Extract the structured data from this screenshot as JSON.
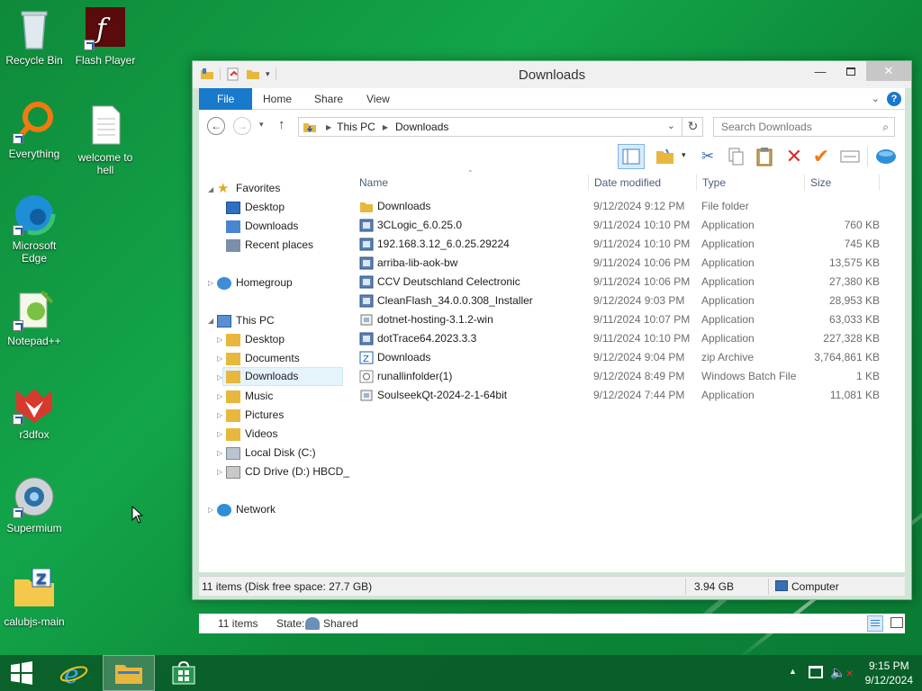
{
  "desktop": {
    "icons": [
      {
        "label": "Recycle Bin"
      },
      {
        "label": "Flash Player"
      },
      {
        "label": "Everything"
      },
      {
        "label": "welcome to hell"
      },
      {
        "label": "Microsoft Edge"
      },
      {
        "label": "Notepad++"
      },
      {
        "label": "r3dfox"
      },
      {
        "label": "Supermium"
      },
      {
        "label": "calubjs-main"
      }
    ]
  },
  "window": {
    "title": "Downloads",
    "ribbon_tabs": [
      "File",
      "Home",
      "Share",
      "View"
    ],
    "address": {
      "segments": [
        "This PC",
        "Downloads"
      ]
    },
    "search_placeholder": "Search Downloads",
    "nav": {
      "favorites": "Favorites",
      "favorites_items": [
        "Desktop",
        "Downloads",
        "Recent places"
      ],
      "homegroup": "Homegroup",
      "this_pc": "This PC",
      "this_pc_items": [
        "Desktop",
        "Documents",
        "Downloads",
        "Music",
        "Pictures",
        "Videos",
        "Local Disk (C:)",
        "CD Drive (D:) HBCD_"
      ],
      "network": "Network"
    },
    "columns": {
      "name": "Name",
      "date": "Date modified",
      "type": "Type",
      "size": "Size"
    },
    "files": [
      {
        "name": "Downloads",
        "date": "9/12/2024 9:12 PM",
        "type": "File folder",
        "size": "",
        "icon": "folder-icon"
      },
      {
        "name": "3CLogic_6.0.25.0",
        "date": "9/11/2024 10:10 PM",
        "type": "Application",
        "size": "760 KB",
        "icon": "app-icon"
      },
      {
        "name": "192.168.3.12_6.0.25.29224",
        "date": "9/11/2024 10:10 PM",
        "type": "Application",
        "size": "745 KB",
        "icon": "app-icon"
      },
      {
        "name": "arriba-lib-aok-bw",
        "date": "9/11/2024 10:06 PM",
        "type": "Application",
        "size": "13,575 KB",
        "icon": "app-icon"
      },
      {
        "name": "CCV Deutschland Celectronic",
        "date": "9/11/2024 10:06 PM",
        "type": "Application",
        "size": "27,380 KB",
        "icon": "app-icon"
      },
      {
        "name": "CleanFlash_34.0.0.308_Installer",
        "date": "9/12/2024 9:03 PM",
        "type": "Application",
        "size": "28,953 KB",
        "icon": "app-icon"
      },
      {
        "name": "dotnet-hosting-3.1.2-win",
        "date": "9/11/2024 10:07 PM",
        "type": "Application",
        "size": "63,033 KB",
        "icon": "installer-icon"
      },
      {
        "name": "dotTrace64.2023.3.3",
        "date": "9/11/2024 10:10 PM",
        "type": "Application",
        "size": "227,328 KB",
        "icon": "app-icon"
      },
      {
        "name": "Downloads",
        "date": "9/12/2024 9:04 PM",
        "type": "zip Archive",
        "size": "3,764,861 KB",
        "icon": "zip-icon"
      },
      {
        "name": "runallinfolder(1)",
        "date": "9/12/2024 8:49 PM",
        "type": "Windows Batch File",
        "size": "1 KB",
        "icon": "batch-icon"
      },
      {
        "name": "SoulseekQt-2024-2-1-64bit",
        "date": "9/12/2024 7:44 PM",
        "type": "Application",
        "size": "11,081 KB",
        "icon": "installer-icon"
      }
    ],
    "status": {
      "items": "11 items",
      "state_label": "State:",
      "state_value": "Shared"
    },
    "bottom_status": {
      "left": "11 items (Disk free space: 27.7 GB)",
      "size": "3.94 GB",
      "location": "Computer"
    }
  },
  "taskbar": {
    "time": "9:15 PM",
    "date": "9/12/2024"
  },
  "colors": {
    "accent": "#1979ca",
    "desktop": "#13a54a",
    "window_frame": "#cfe6d6"
  }
}
